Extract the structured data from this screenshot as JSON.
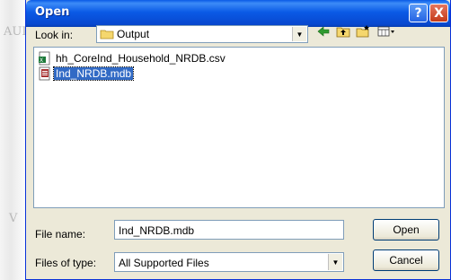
{
  "dialog": {
    "title": "Open",
    "help_button": "?",
    "close_button": "X"
  },
  "look_in": {
    "label": "Look in:",
    "value": "Output"
  },
  "files": [
    {
      "name": "hh_CoreInd_Household_NRDB.csv",
      "type": "csv-file",
      "selected": false
    },
    {
      "name": "Ind_NRDB.mdb",
      "type": "access-database-file",
      "selected": true
    }
  ],
  "file_name": {
    "label": "File name:",
    "value": "Ind_NRDB.mdb"
  },
  "files_of_type": {
    "label": "Files of type:",
    "value": "All Supported Files"
  },
  "buttons": {
    "open": "Open",
    "cancel": "Cancel"
  },
  "background_text": {
    "top": "AUI",
    "middle": "V"
  }
}
